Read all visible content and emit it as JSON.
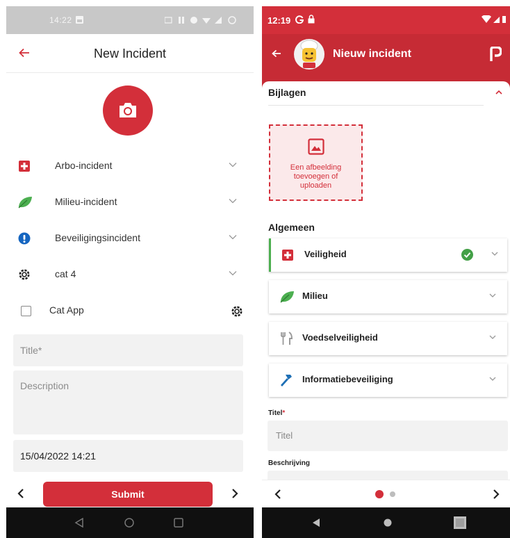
{
  "left": {
    "status": {
      "time": "14:22"
    },
    "header": {
      "title": "New Incident"
    },
    "categories": [
      {
        "label": "Arbo-incident",
        "icon": "red-cross-icon"
      },
      {
        "label": "Milieu-incident",
        "icon": "leaf-icon"
      },
      {
        "label": "Beveiligingsincident",
        "icon": "info-icon"
      },
      {
        "label": "cat 4",
        "icon": "gear-icon"
      }
    ],
    "app_checkbox": {
      "label": "Cat App"
    },
    "form": {
      "title_placeholder": "Title*",
      "description_placeholder": "Description",
      "date_value": "15/04/2022 14:21"
    },
    "submit_label": "Submit"
  },
  "right": {
    "status": {
      "time": "12:19"
    },
    "header": {
      "title": "Nieuw incident"
    },
    "attachments": {
      "title": "Bijlagen",
      "upload_text": [
        "Een afbeelding",
        "toevoegen of",
        "uploaden"
      ]
    },
    "general": {
      "title": "Algemeen"
    },
    "categories": [
      {
        "label": "Veiligheid",
        "icon": "red-cross-icon",
        "selected": true
      },
      {
        "label": "Milieu",
        "icon": "leaf-icon",
        "selected": false
      },
      {
        "label": "Voedselveiligheid",
        "icon": "fork-knife-icon",
        "selected": false
      },
      {
        "label": "Informatiebeveiliging",
        "icon": "hammer-icon",
        "selected": false
      }
    ],
    "form": {
      "title_label": "Titel",
      "required_mark": "*",
      "title_placeholder": "Titel",
      "description_label": "Beschrijving"
    },
    "pager": {
      "pages": 2,
      "current": 1
    }
  },
  "colors": {
    "brand_red": "#d32f3a",
    "leaf_green": "#4caf50",
    "info_blue": "#1565c0",
    "tool_blue": "#1e6fb5",
    "check_green": "#43a047"
  }
}
